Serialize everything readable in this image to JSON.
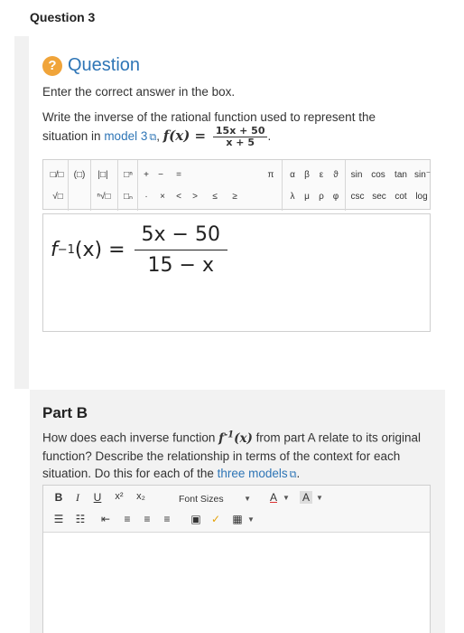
{
  "question_title": "Question 3",
  "question_header": {
    "icon": "?",
    "label": "Question"
  },
  "instruction": "Enter the correct answer in the box.",
  "prompt": {
    "text1": "Write the inverse of the rational function used to represent the situation in",
    "link": "model 3",
    "text2": ",",
    "fx": "f(x) =",
    "frac_num": "15x + 50",
    "frac_den": "x + 5",
    "end": "."
  },
  "math_toolbar": {
    "row1": [
      "□/□",
      "(□)",
      "|□|",
      "□ⁿ",
      "+",
      "−",
      "=",
      "π",
      "α",
      "β",
      "ε",
      "ϑ",
      "sin",
      "cos",
      "tan",
      "sin⁻"
    ],
    "row2": [
      "√□",
      "ⁿ√□",
      "□ₙ",
      "·",
      "×",
      "<",
      ">",
      "≤",
      "≥",
      "λ",
      "μ",
      "ρ",
      "φ",
      "csc",
      "sec",
      "cot",
      "log"
    ]
  },
  "answer": {
    "lhs_f": "f",
    "lhs_exp": "−1",
    "lhs_rest": "(x) =",
    "num": "5x − 50",
    "den": "15 − x"
  },
  "part_b": {
    "title": "Part B",
    "text1": "How does each inverse function",
    "fn": "f",
    "fn_exp": "-1",
    "fn_rest": "(x)",
    "text2": "from part A relate to its original function? Describe the relationship in terms of the context for each situation. Do this for each of the",
    "link": "three models",
    "end": "."
  },
  "editor_toolbar": {
    "bold": "B",
    "italic": "I",
    "underline": "U",
    "superscript": "x²",
    "subscript": "x₂",
    "font_sizes": "Font Sizes",
    "font_color": "A",
    "bg_color": "A"
  }
}
